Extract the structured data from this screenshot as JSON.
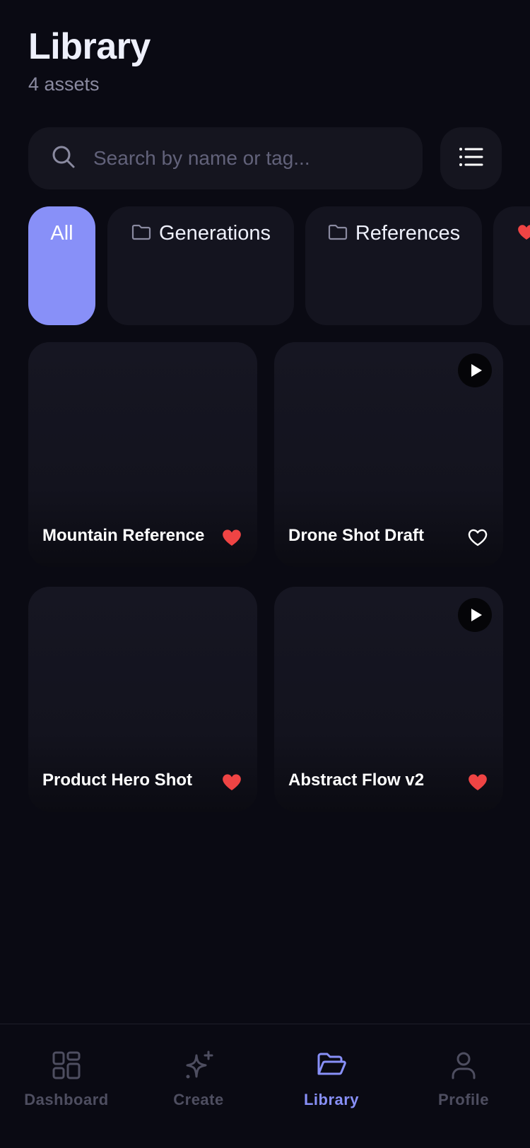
{
  "header": {
    "title": "Library",
    "subtitle": "4 assets"
  },
  "search": {
    "placeholder": "Search by name or tag..."
  },
  "filters": [
    {
      "label": "All",
      "icon": "",
      "active": true
    },
    {
      "label": "Generations",
      "icon": "folder-icon",
      "active": false
    },
    {
      "label": "References",
      "icon": "folder-icon",
      "active": false
    },
    {
      "label": "",
      "icon": "heart-icon",
      "active": false
    }
  ],
  "assets": [
    {
      "title": "Mountain Reference",
      "favorite": true,
      "video": false
    },
    {
      "title": "Drone Shot Draft",
      "favorite": false,
      "video": true
    },
    {
      "title": "Product Hero Shot",
      "favorite": true,
      "video": false
    },
    {
      "title": "Abstract Flow v2",
      "favorite": true,
      "video": true
    }
  ],
  "nav": {
    "dashboard": "Dashboard",
    "create": "Create",
    "library": "Library",
    "profile": "Profile",
    "active": "library"
  },
  "colors": {
    "accent": "#8890f8",
    "favorite": "#ef4444",
    "background": "#0a0a13",
    "surface": "#15151f"
  }
}
